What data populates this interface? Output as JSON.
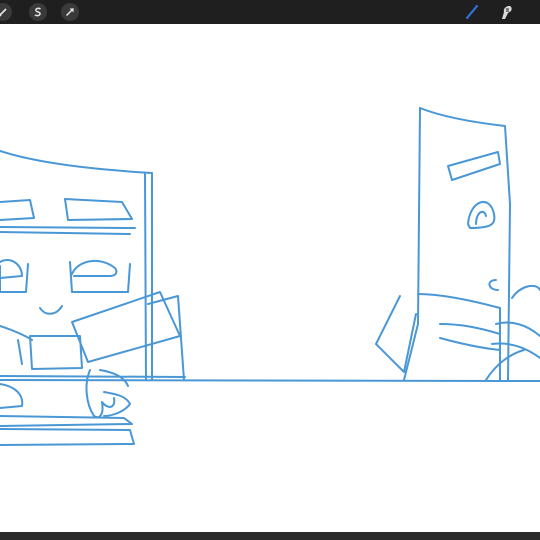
{
  "toolbar": {
    "left_tools": [
      "adjustments-icon",
      "selection-icon",
      "transform-icon"
    ],
    "right_tools": [
      "brush-icon",
      "smudge-icon"
    ],
    "active_color": "#2f6fd0"
  },
  "canvas": {
    "background": "#ffffff",
    "stroke_color": "#4a97d6"
  }
}
